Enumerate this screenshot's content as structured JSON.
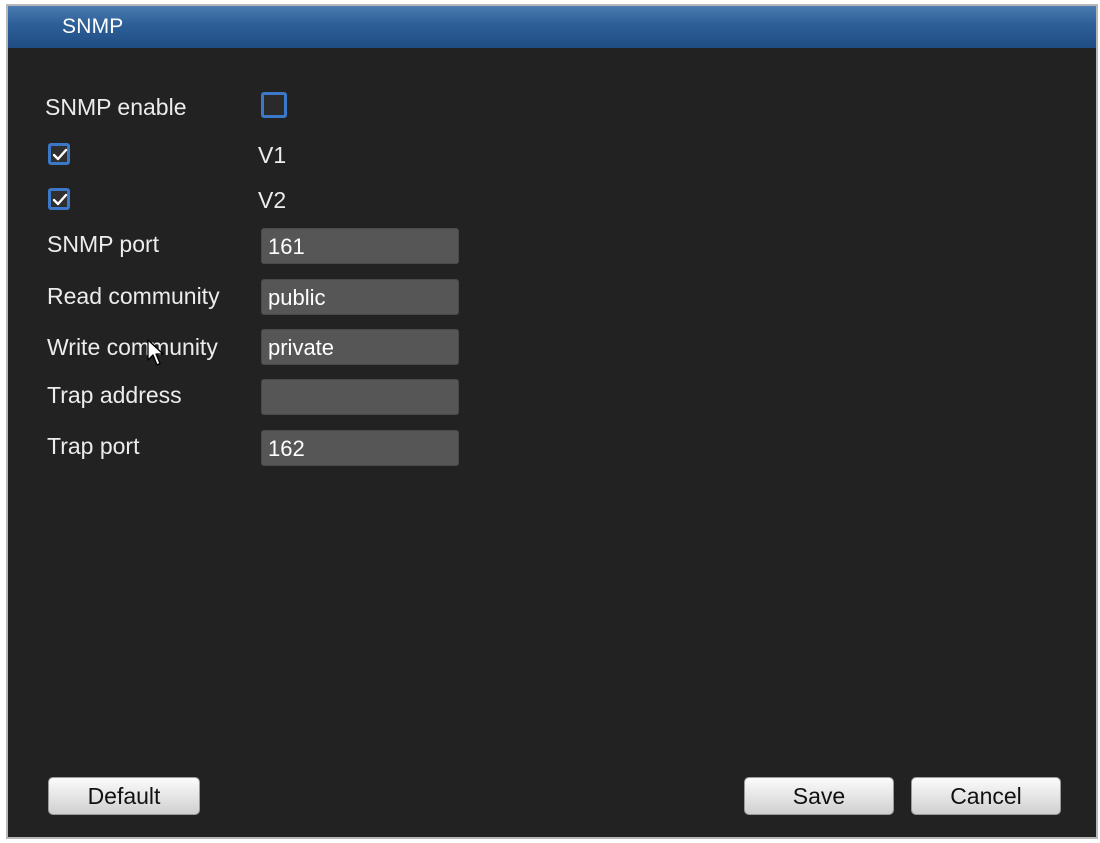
{
  "window": {
    "title": "SNMP"
  },
  "form": {
    "snmp_enable": {
      "label": "SNMP enable",
      "checked": false
    },
    "v1": {
      "label": "V1",
      "checked": true
    },
    "v2": {
      "label": "V2",
      "checked": true
    },
    "snmp_port": {
      "label": "SNMP port",
      "value": "161"
    },
    "read_community": {
      "label": "Read community",
      "value": "public"
    },
    "write_community": {
      "label": "Write community",
      "value": "private"
    },
    "trap_address": {
      "label": "Trap address",
      "value": ""
    },
    "trap_port": {
      "label": "Trap port",
      "value": "162"
    }
  },
  "buttons": {
    "default": "Default",
    "save": "Save",
    "cancel": "Cancel"
  },
  "colors": {
    "titlebar": "#2d5f97",
    "background": "#222222",
    "checkbox_border": "#3c78c8",
    "input_bg": "#565656"
  },
  "icons": {
    "check": "checkmark-icon",
    "cursor": "mouse-pointer-icon"
  }
}
